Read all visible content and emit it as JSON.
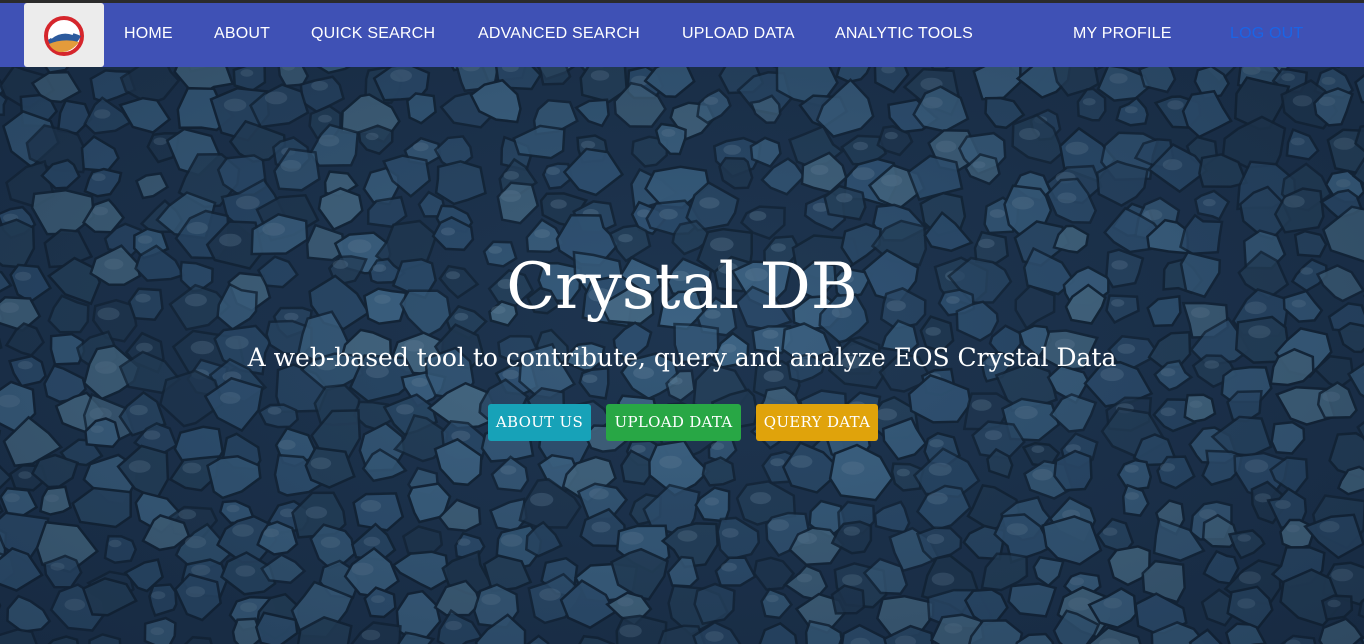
{
  "nav": {
    "logo": "crystaldb-logo",
    "links": [
      "HOME",
      "ABOUT",
      "QUICK SEARCH",
      "ADVANCED SEARCH",
      "UPLOAD DATA",
      "ANALYTIC TOOLS"
    ],
    "profile": "MY PROFILE",
    "logout": "LOG OUT"
  },
  "hero": {
    "title": "Crystal DB",
    "subtitle": "A web-based tool to contribute, query and analyze EOS Crystal Data",
    "buttons": {
      "about": "ABOUT US",
      "upload": "UPLOAD DATA",
      "query": "QUERY DATA"
    }
  },
  "colors": {
    "navbar": "#3f51b5",
    "about_button": "#17a2b8",
    "upload_button": "#28a745",
    "query_button": "#e0a30b",
    "logout_link": "#1a64e6"
  }
}
